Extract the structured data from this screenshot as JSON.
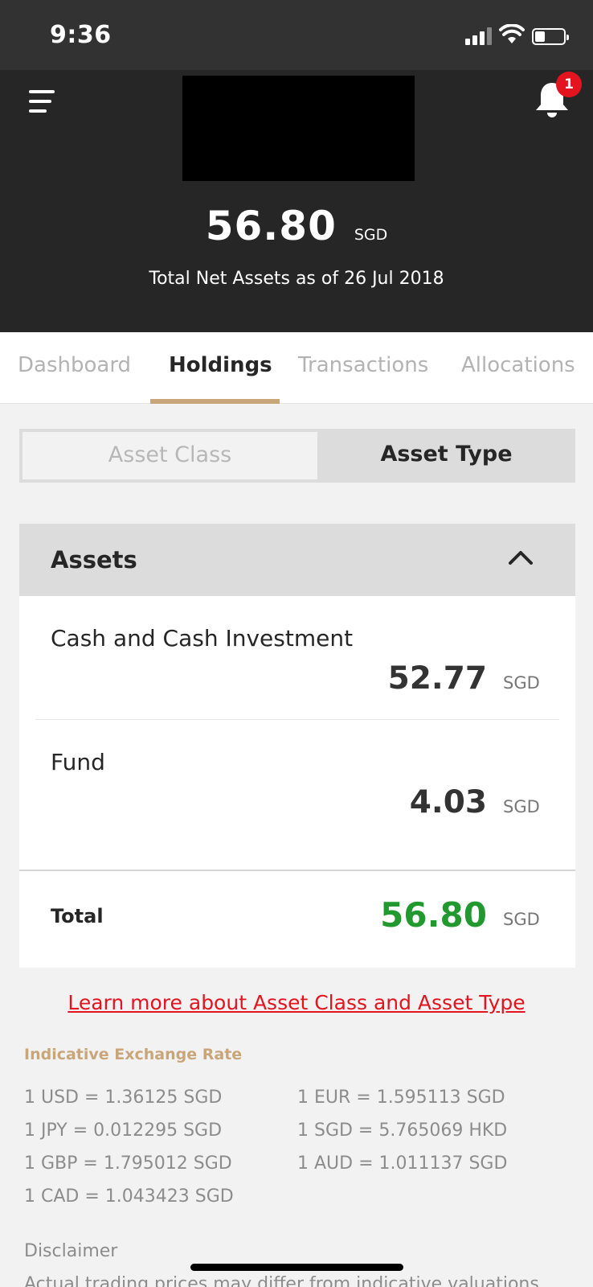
{
  "status_bar": {
    "time": "9:36"
  },
  "header": {
    "notification_count": "1",
    "net_assets": {
      "amount": "56.80",
      "currency": "SGD",
      "caption": "Total Net Assets as of 26 Jul 2018"
    }
  },
  "tabs": [
    {
      "label": "Dashboard",
      "active": false
    },
    {
      "label": "Holdings",
      "active": true
    },
    {
      "label": "Transactions",
      "active": false
    },
    {
      "label": "Allocations",
      "active": false
    }
  ],
  "segmented": {
    "left_label": "Asset Class",
    "right_label": "Asset Type",
    "selected": "Asset Type"
  },
  "assets": {
    "title": "Assets",
    "rows": [
      {
        "name": "Cash and Cash Investment",
        "value": "52.77",
        "currency": "SGD"
      },
      {
        "name": "Fund",
        "value": "4.03",
        "currency": "SGD"
      }
    ],
    "total": {
      "label": "Total",
      "value": "56.80",
      "currency": "SGD"
    }
  },
  "learn_more_link": "Learn more about Asset Class and Asset Type",
  "exchange_rates": {
    "heading": "Indicative Exchange Rate",
    "left": [
      "1 USD = 1.36125 SGD",
      "1 JPY = 0.012295 SGD",
      "1 GBP = 1.795012 SGD",
      "1 CAD = 1.043423 SGD"
    ],
    "right": [
      "1 EUR = 1.595113 SGD",
      "1 SGD = 5.765069 HKD",
      "1 AUD = 1.011137 SGD"
    ]
  },
  "disclaimer": {
    "title": "Disclaimer",
    "text": "Actual trading prices may differ from indicative valuations"
  },
  "colors": {
    "header_bg": "#262626",
    "accent_gold": "#c9a57a",
    "positive_green": "#22992f",
    "link_red": "#e3141f"
  }
}
